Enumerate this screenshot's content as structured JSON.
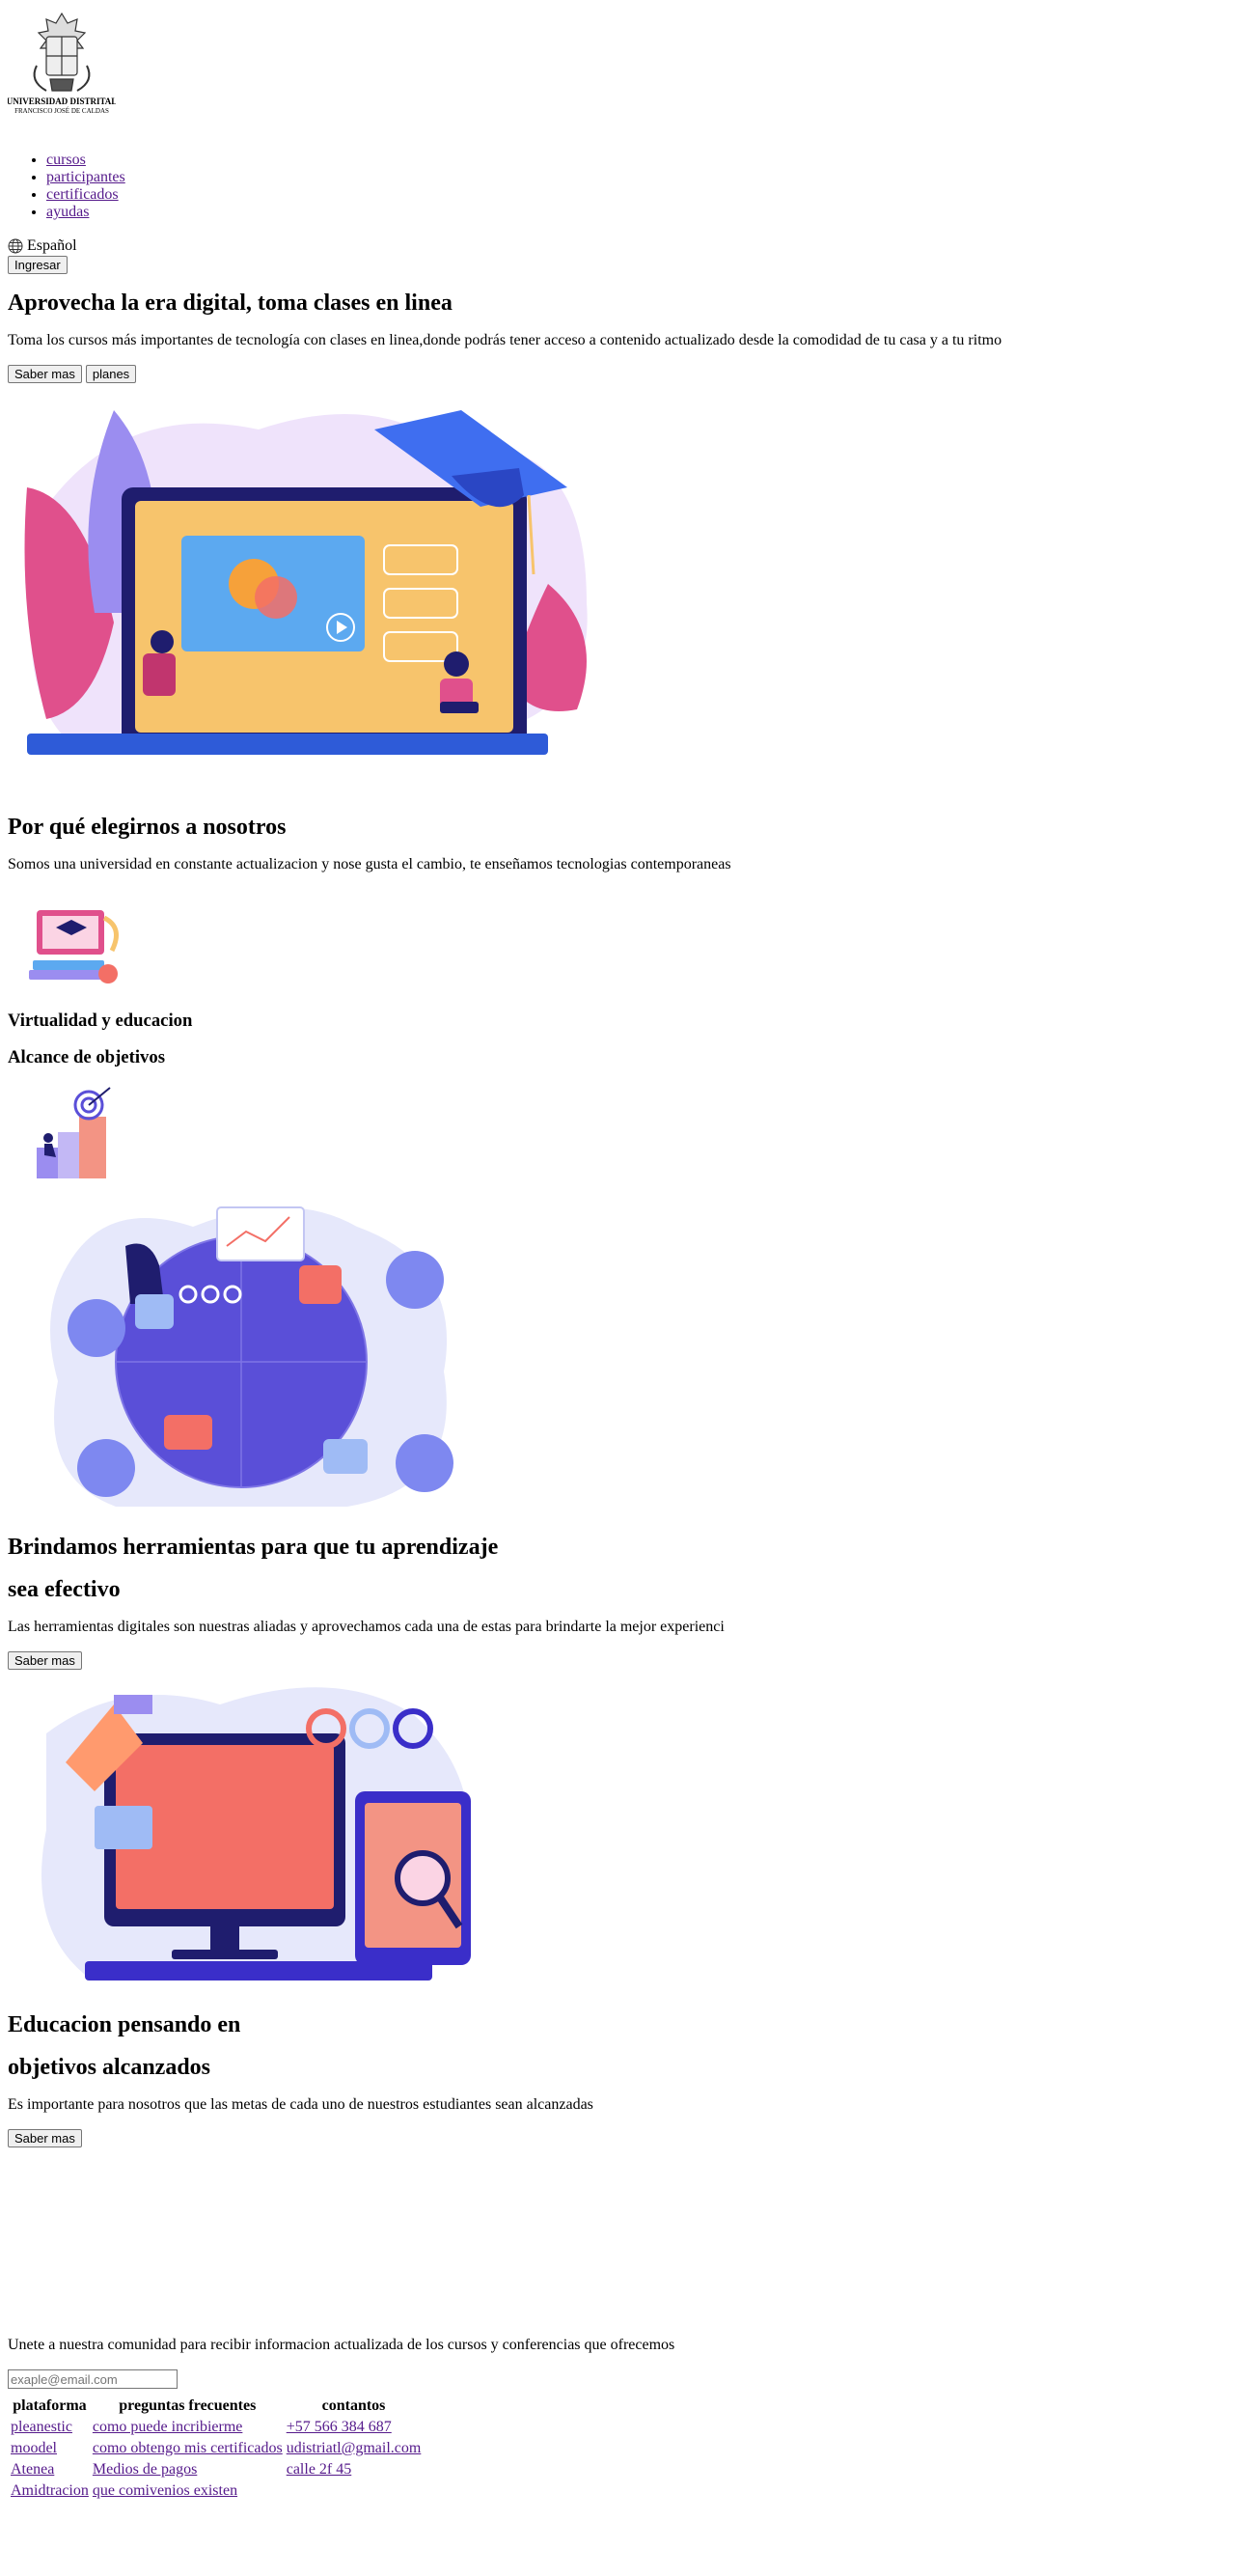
{
  "header": {
    "logo_line1": "UNIVERSIDAD DISTRITAL",
    "logo_line2": "FRANCISCO JOSÉ DE CALDAS",
    "nav": [
      "cursos",
      "participantes",
      "certificados",
      "ayudas"
    ],
    "language": "Español",
    "login_label": "Ingresar"
  },
  "hero": {
    "title": "Aprovecha la era digital, toma clases en linea",
    "text": "Toma los cursos más importantes de tecnología con clases en linea,donde podrás tener acceso a contenido actualizado desde la comodidad de tu casa y a tu ritmo",
    "btn_more": "Saber mas",
    "btn_plans": "planes"
  },
  "why": {
    "title": "Por qué elegirnos a nosotros",
    "text": "Somos una universidad en constante actualizacion y nose gusta el cambio, te enseñamos tecnologias contemporaneas",
    "item1": "Virtualidad y educacion",
    "item2": "Alcance de objetivos"
  },
  "tools": {
    "title1": "Brindamos herramientas para que tu aprendizaje",
    "title2": "sea efectivo",
    "text": "Las herramientas digitales son nuestras aliadas y aprovechamos cada una de estas para brindarte la mejor experienci",
    "btn": "Saber mas"
  },
  "goals": {
    "title1": "Educacion pensando en",
    "title2": "objetivos alcanzados",
    "text": "Es importante para nosotros que las metas de cada uno de nuestros estudiantes sean alcanzadas",
    "btn": "Saber mas"
  },
  "newsletter": {
    "text": "Unete a nuestra comunidad para recibir informacion actualizada de los cursos y conferencias que ofrecemos",
    "placeholder": "exaple@email.com"
  },
  "footer": {
    "headers": [
      "plataforma",
      "preguntas frecuentes",
      "contantos"
    ],
    "rows": [
      [
        "pleanestic",
        "como puede incribierme",
        "+57 566 384 687"
      ],
      [
        "moodel",
        "como obtengo mis certificados",
        "udistriatl@gmail.com"
      ],
      [
        "Atenea",
        "Medios de pagos",
        "calle 2f 45"
      ],
      [
        "Amidtracion",
        "que comivenios existen",
        ""
      ]
    ]
  },
  "colors": {
    "link": "#551a8b",
    "illus_purple": "#5a4fd8",
    "illus_pink": "#e0508c",
    "illus_coral": "#f36f66",
    "illus_navy": "#1f1d6e"
  }
}
